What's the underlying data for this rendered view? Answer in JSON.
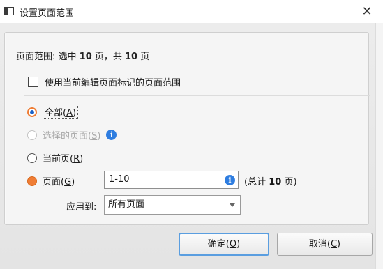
{
  "window": {
    "title": "设置页面范围",
    "close_glyph": "✕"
  },
  "summary": {
    "prefix": "页面范围: 选中 ",
    "selected": "10",
    "middle": " 页，共 ",
    "total": "10",
    "suffix": " 页"
  },
  "options": {
    "use_current_marked": "使用当前编辑页面标记的页面范围",
    "all_label": "全部(",
    "all_key": "A",
    "selected_pages_label": "选择的页面(",
    "selected_pages_key": "S",
    "current_page_label": "当前页(",
    "current_page_key": "R",
    "pages_label": "页面(",
    "pages_key": "G",
    "close_paren": ")"
  },
  "pages": {
    "value": "1-10",
    "total_prefix": "(总计 ",
    "total_count": "10",
    "total_suffix": " 页)"
  },
  "apply_to": {
    "label": "应用到:",
    "value": "所有页面"
  },
  "buttons": {
    "ok_label": "确定(",
    "ok_key": "O",
    "cancel_label": "取消(",
    "cancel_key": "C",
    "close_paren": ")"
  },
  "icons": {
    "info": "i"
  },
  "colors": {
    "accent_orange": "#ef7d35",
    "radio_dot_blue": "#1a62c8",
    "info_blue": "#2e7de0",
    "ok_border": "#5a9ee0"
  }
}
